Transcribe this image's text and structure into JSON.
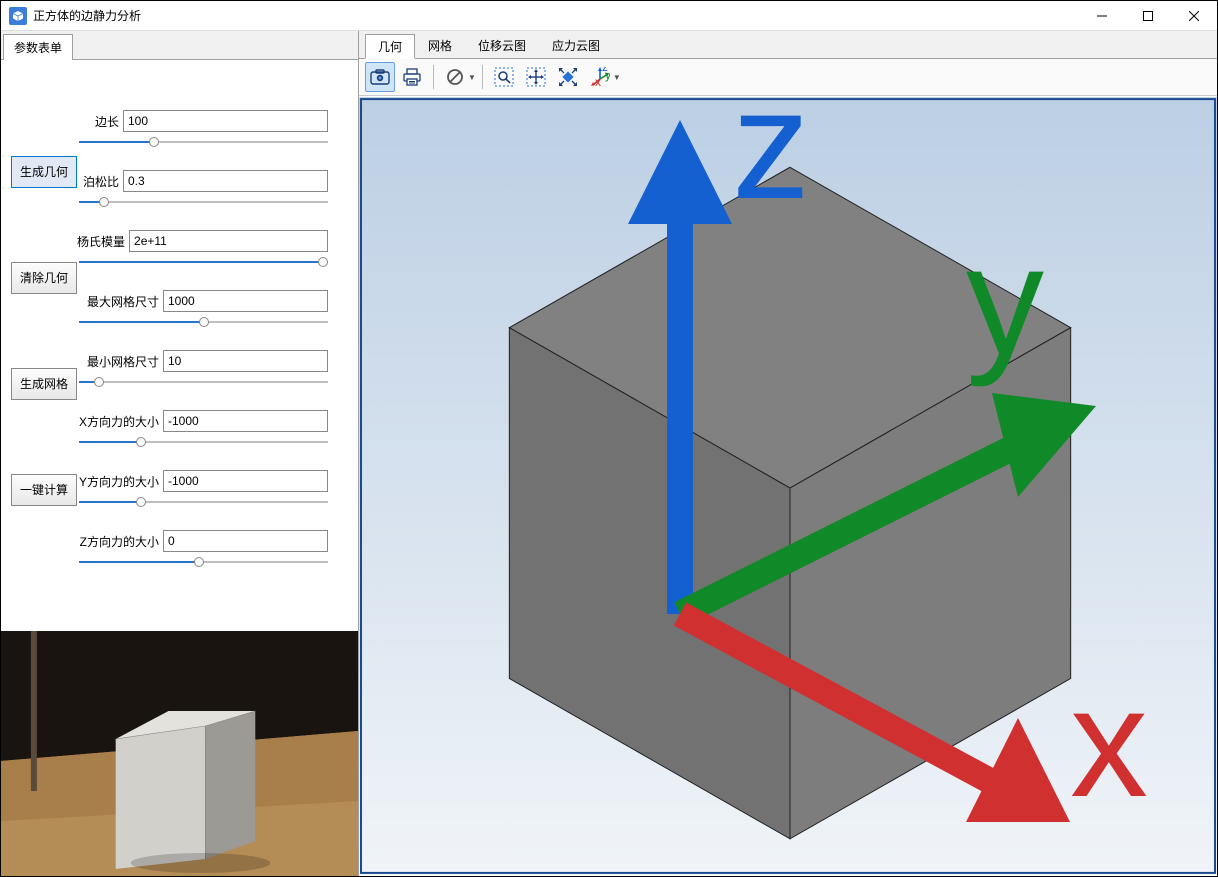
{
  "window": {
    "title": "正方体的边静力分析"
  },
  "leftTab": "参数表单",
  "buttons": {
    "genGeom": "生成几何",
    "clearGeom": "清除几何",
    "genMesh": "生成网格",
    "oneClick": "一键计算"
  },
  "fields": {
    "edge": {
      "label": "边长",
      "value": "100",
      "pct": 30,
      "longLabel": false
    },
    "poisson": {
      "label": "泊松比",
      "value": "0.3",
      "pct": 10,
      "longLabel": false
    },
    "young": {
      "label": "杨氏模量",
      "value": "2e+11",
      "pct": 98,
      "longLabel": false
    },
    "maxMesh": {
      "label": "最大网格尺寸",
      "value": "1000",
      "pct": 50,
      "longLabel": true
    },
    "minMesh": {
      "label": "最小网格尺寸",
      "value": "10",
      "pct": 8,
      "longLabel": true
    },
    "fx": {
      "label": "X方向力的大小",
      "value": "-1000",
      "pct": 25,
      "longLabel": true
    },
    "fy": {
      "label": "Y方向力的大小",
      "value": "-1000",
      "pct": 25,
      "longLabel": true
    },
    "fz": {
      "label": "Z方向力的大小",
      "value": "0",
      "pct": 48,
      "longLabel": true
    }
  },
  "rightTabs": {
    "geom": "几何",
    "mesh": "网格",
    "disp": "位移云图",
    "stress": "应力云图"
  },
  "axis": {
    "x": "x",
    "y": "y",
    "z": "z"
  }
}
